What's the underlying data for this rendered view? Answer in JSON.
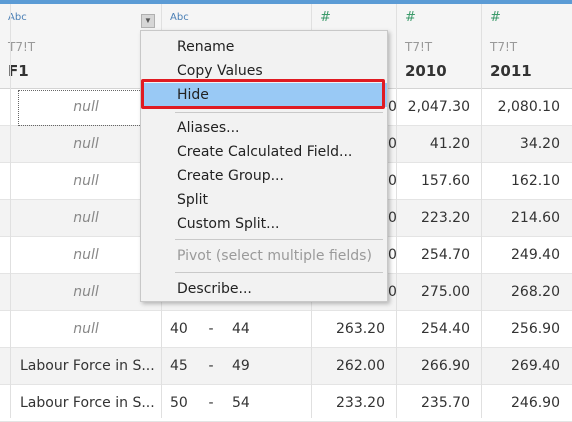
{
  "columns": [
    {
      "type_icon": "Abc",
      "sub_label": "T7!T",
      "name": "F1"
    },
    {
      "type_icon": "Abc",
      "sub_label": "",
      "name": ""
    },
    {
      "type_icon": "#",
      "sub_label": "",
      "name": ""
    },
    {
      "type_icon": "#",
      "sub_label": "T7!T",
      "name": "2010"
    },
    {
      "type_icon": "#",
      "sub_label": "T7!T",
      "name": "2011"
    }
  ],
  "rows": [
    {
      "f1": "null",
      "c2a": "",
      "c2b": "",
      "c3": "",
      "y2010": "2,047.30",
      "y2011": "2,080.10"
    },
    {
      "f1": "null",
      "c2a": "",
      "c2b": "",
      "c3": "",
      "y2010": "41.20",
      "y2011": "34.20"
    },
    {
      "f1": "null",
      "c2a": "",
      "c2b": "",
      "c3": "",
      "y2010": "157.60",
      "y2011": "162.10"
    },
    {
      "f1": "null",
      "c2a": "",
      "c2b": "",
      "c3": "",
      "y2010": "223.20",
      "y2011": "214.60"
    },
    {
      "f1": "null",
      "c2a": "",
      "c2b": "",
      "c3": "",
      "y2010": "254.70",
      "y2011": "249.40"
    },
    {
      "f1": "null",
      "c2a": "",
      "c2b": "",
      "c3": "",
      "y2010": "275.00",
      "y2011": "268.20"
    },
    {
      "f1": "null",
      "c2a": "40",
      "c2b": "44",
      "c3": "263.20",
      "y2010": "254.40",
      "y2011": "256.90"
    },
    {
      "f1": "Labour Force in S...",
      "c2a": "45",
      "c2b": "49",
      "c3": "262.00",
      "y2010": "266.90",
      "y2011": "269.40"
    },
    {
      "f1": "Labour Force in S...",
      "c2a": "50",
      "c2b": "54",
      "c3": "233.20",
      "y2010": "235.70",
      "y2011": "246.90"
    }
  ],
  "menu_tail_digits": [
    "0",
    "0",
    "0",
    "0",
    "0",
    "0"
  ],
  "menu": {
    "rename": "Rename",
    "copy_values": "Copy Values",
    "hide": "Hide",
    "aliases": "Aliases...",
    "create_calc": "Create Calculated Field...",
    "create_group": "Create Group...",
    "split": "Split",
    "custom_split": "Custom Split...",
    "pivot": "Pivot (select multiple fields)",
    "describe": "Describe..."
  },
  "range_dash": "-",
  "dropdown_arrow": "▼"
}
